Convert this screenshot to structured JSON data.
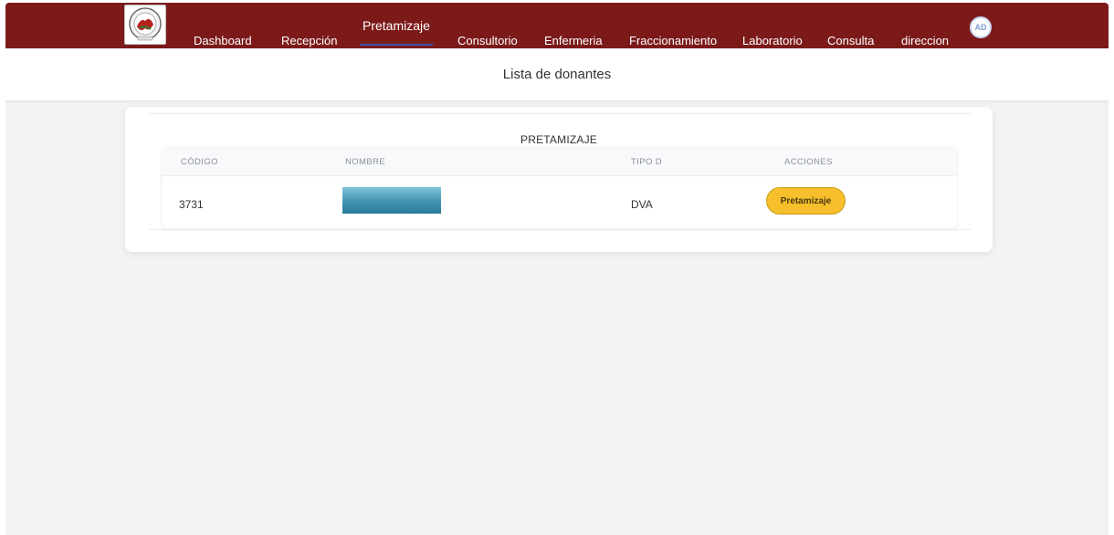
{
  "nav": {
    "logo_icon": "hospital-seal-logo",
    "items": [
      {
        "label": "Dashboard"
      },
      {
        "label": "Recepción"
      },
      {
        "label": "Pretamizaje",
        "active": true
      },
      {
        "label": "Consultorio"
      },
      {
        "label": "Enfermeria"
      },
      {
        "label": "Fraccionamiento"
      },
      {
        "label": "Laboratorio"
      },
      {
        "label": "Consulta"
      },
      {
        "label": "direccion"
      }
    ],
    "avatar_initials": "AD"
  },
  "page": {
    "title": "Lista de donantes"
  },
  "section": {
    "title": "PRETAMIZAJE"
  },
  "table": {
    "headers": [
      "CÓDIGO",
      "NOMBRE",
      "TIPO D",
      "ACCIONES"
    ],
    "rows": [
      {
        "codigo": "3731",
        "nombre": "",
        "tipo": "DVA",
        "action_label": "Pretamizaje"
      }
    ]
  },
  "colors": {
    "navbar": "#7c1a1a",
    "accent_underline": "#3a4fb0",
    "action_button": "#f6bf2b",
    "background": "#f2f3f5"
  }
}
